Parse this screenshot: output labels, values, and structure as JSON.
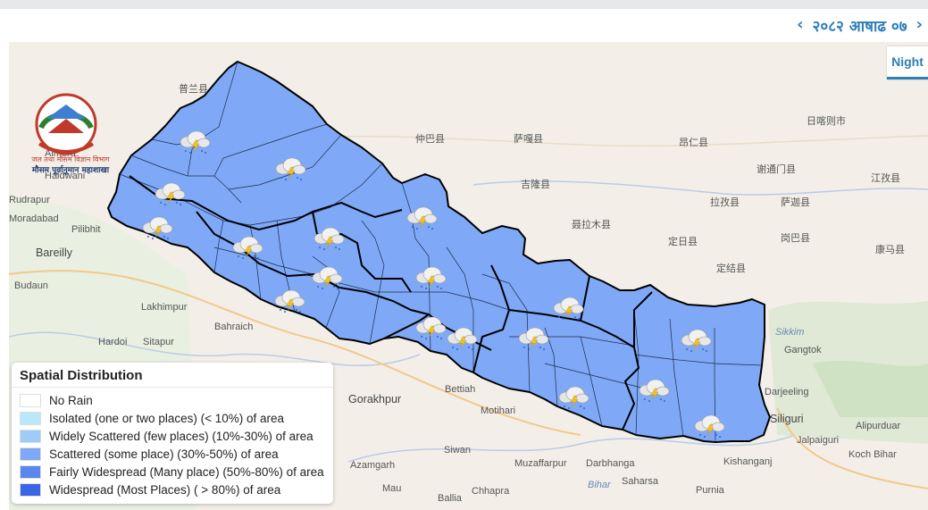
{
  "header": {
    "date_text": "२०८२ आषाढ ०७",
    "prev_icon": "chevron-left-icon",
    "next_icon": "chevron-right-icon",
    "accent_color": "#2d7fb8"
  },
  "toolbar": {
    "night_label": "Night"
  },
  "logo": {
    "line1": "जल तथा मौसम विज्ञान विभाग",
    "line2": "मौसम पूर्वानुमान महाशाखा"
  },
  "map": {
    "places": {
      "almora": "Almora",
      "haldwani": "Haldwani",
      "rudrapur": "Rudrapur",
      "moradabad": "Moradabad",
      "pilibhit": "Pilibhit",
      "bareilly": "Bareilly",
      "budaun": "Budaun",
      "lakhimpur": "Lakhimpur",
      "bahraich": "Bahraich",
      "hardoi": "Hardoi",
      "sitapur": "Sitapur",
      "gorakhpur": "Gorakhpur",
      "bettiah": "Bettiah",
      "motihari": "Motihari",
      "siwan": "Siwan",
      "muzaffarpur": "Muzaffarpur",
      "darbhanga": "Darbhanga",
      "saharsa": "Saharsa",
      "purnia": "Purnia",
      "azamgarh": "Azamgarh",
      "mau": "Mau",
      "ballia": "Ballia",
      "chhapra": "Chhapra",
      "bihar": "Bihar",
      "kishanganj": "Kishanganj",
      "siliguri": "Siliguri",
      "jalpaiguri": "Jalpaiguri",
      "alipurduar": "Alipurduar",
      "cooch_behar": "Koch Bihar",
      "gangtok": "Gangtok",
      "sikkim": "Sikkim",
      "darjeeling": "Darjeeling",
      "zhongba": "仲巴县",
      "saga": "萨嘎县",
      "jilong": "吉隆县",
      "nyalam": "聂拉木县",
      "dingri": "定日县",
      "dingjie": "定结县",
      "gamba": "岗巴县",
      "kangma": "康马县",
      "shigatse": "日喀则市",
      "angren": "昂仁县",
      "sakya": "萨迦县",
      "xietongmen": "谢通门县",
      "lazi": "拉孜县",
      "jiangzi": "江孜县",
      "pulan": "普兰县"
    }
  },
  "legend": {
    "title": "Spatial Distribution",
    "items": [
      {
        "label": "No Rain",
        "color": "#ffffff"
      },
      {
        "label": "Isolated (one or two places) (< 10%) of area",
        "color": "#b7e9fb"
      },
      {
        "label": "Widely Scattered (few places) (10%-30%) of area",
        "color": "#9fcbfa"
      },
      {
        "label": "Scattered (some place) (30%-50%) of area",
        "color": "#7fa9f7"
      },
      {
        "label": "Fairly Widespread (Many place) (50%-80%) of area",
        "color": "#5b86f0"
      },
      {
        "label": "Widespread (Most Places) ( > 80%) of area",
        "color": "#3a66e6"
      }
    ]
  },
  "forecast": {
    "region_fill": "#7fa9f7",
    "weather_icon": "thunderstorm-rain-icon",
    "distribution": "Scattered (some place) (30%-50%) of area"
  }
}
